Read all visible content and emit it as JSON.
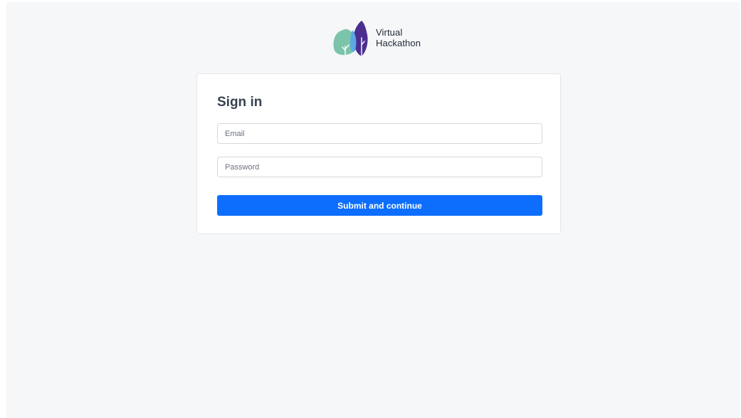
{
  "brand": {
    "name_line1": "Virtual",
    "name_line2": "Hackathon",
    "logo_icon": "twin-leaves-logo-icon",
    "colors": {
      "leaf_teal": "#7cc4a9",
      "leaf_blue": "#5aa9e6",
      "leaf_purple": "#4b2f8f"
    }
  },
  "signin": {
    "title": "Sign in",
    "email_placeholder": "Email",
    "email_value": "",
    "password_placeholder": "Password",
    "password_value": "",
    "submit_label": "Submit and continue"
  },
  "theme": {
    "accent": "#0d6efd",
    "page_background": "#f6f7f9",
    "card_background": "#ffffff"
  }
}
